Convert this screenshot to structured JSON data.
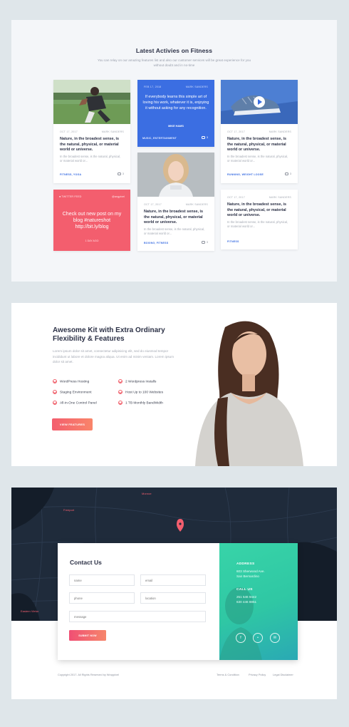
{
  "features_section": {
    "title": "Latest Activies on Fitness",
    "subtitle": "You can relay on our amazing features list and also our customer services will be great experience for you without doubt and in no-time",
    "cards": [
      {
        "date": "OCT 17, 2017",
        "author": "MARK SANDERS",
        "title": "Nature, in the broadest sense, is the natural, physical, or material world or universe.",
        "desc": "In the broadest sense, is the natural, physical, or material world or...",
        "tags": "FITNESS, YOGA",
        "comments": "3"
      },
      {
        "date": "FEB 17, 2018",
        "author": "MARK SANDERS",
        "quote": "If everybody learns this simple art of loving his work, whatever it is, enjoying it without asking for any recognition.",
        "quote_author": "MIKE HAMS",
        "tags": "MUSIC, ENTERTAINMENT",
        "comments": "3"
      },
      {
        "date": "OCT 17, 2017",
        "author": "MARK SANDERS",
        "title": "Nature, in the broadest sense, is the natural, physical, or material world or universe.",
        "desc": "In the broadest sense, is the natural, physical, or material world or...",
        "tags": "RUNNING, WEIGHT LOOSE",
        "comments": "3"
      },
      {
        "twitter_label": "TWITTER FEED",
        "handle": "@angpixel",
        "tweet": "Check out new post on my blog #natureshot http://bit.ly/blog",
        "time": "1 DAY AGO"
      },
      {
        "date": "OCT 17, 2017",
        "author": "MARK SANDERS",
        "title": "Nature, in the broadest sense, is the natural, physical, or material world or universe.",
        "desc": "In the broadest sense, is the natural, physical, or material world or...",
        "tags": "BOXING, FITNESS",
        "comments": "3"
      },
      {
        "date": "OCT 17, 2017",
        "author": "MARK SANDERS",
        "title": "Nature, in the broadest sense, is the natural, physical, or material world or universe.",
        "desc": "In the broadest sense, is the natural, physical, or material world or...",
        "tags": "FITNESS",
        "comments": "3"
      }
    ]
  },
  "kit_section": {
    "title": "Awesome Kit with Extra Ordinary Flexibility & Features",
    "desc": "Lorem ipsum dolor sit amet, consectetur adipisicing elit, sed do eiusmod tempor incididunt ut labore et dolore magna aliqua. Ut enim ad minim veniam. Lorem ipsum dolor sit amet.",
    "features": [
      "WordPress Hosting",
      "2 Wordpress Installs",
      "Staging Environment",
      "Host Up to 100 Websites",
      "All-in-One Control Panel",
      "1 TB Monthly BandWidth"
    ],
    "button": "VIEW FEATURES"
  },
  "contact_section": {
    "map_labels": [
      "Monroe",
      "Freeport",
      "Eastern Vietor"
    ],
    "title": "Contact Us",
    "placeholders": {
      "name": "name",
      "email": "email",
      "phone": "phone",
      "location": "location",
      "message": "message"
    },
    "submit": "SUBMIT NOW",
    "address_heading": "ADDRESS",
    "address_lines": [
      "603 Sherwood Ave.",
      "San Bernardino"
    ],
    "call_heading": "CALL US",
    "phone_lines": [
      "251 546 9442",
      "630 446 8851"
    ],
    "social_icons": [
      "facebook-icon",
      "twitter-icon",
      "email-icon"
    ],
    "footer": {
      "copyright": "Copyright 2017. All Rights Reserved by Wrappixel",
      "links": [
        "Terms & Condition",
        "Privacy Policy",
        "Legal Disclaimer"
      ]
    }
  },
  "colors": {
    "accent_blue": "#3b6ee2",
    "coral": "#f35e6e",
    "teal": "#2fc7a4",
    "dark": "#2c3146"
  }
}
